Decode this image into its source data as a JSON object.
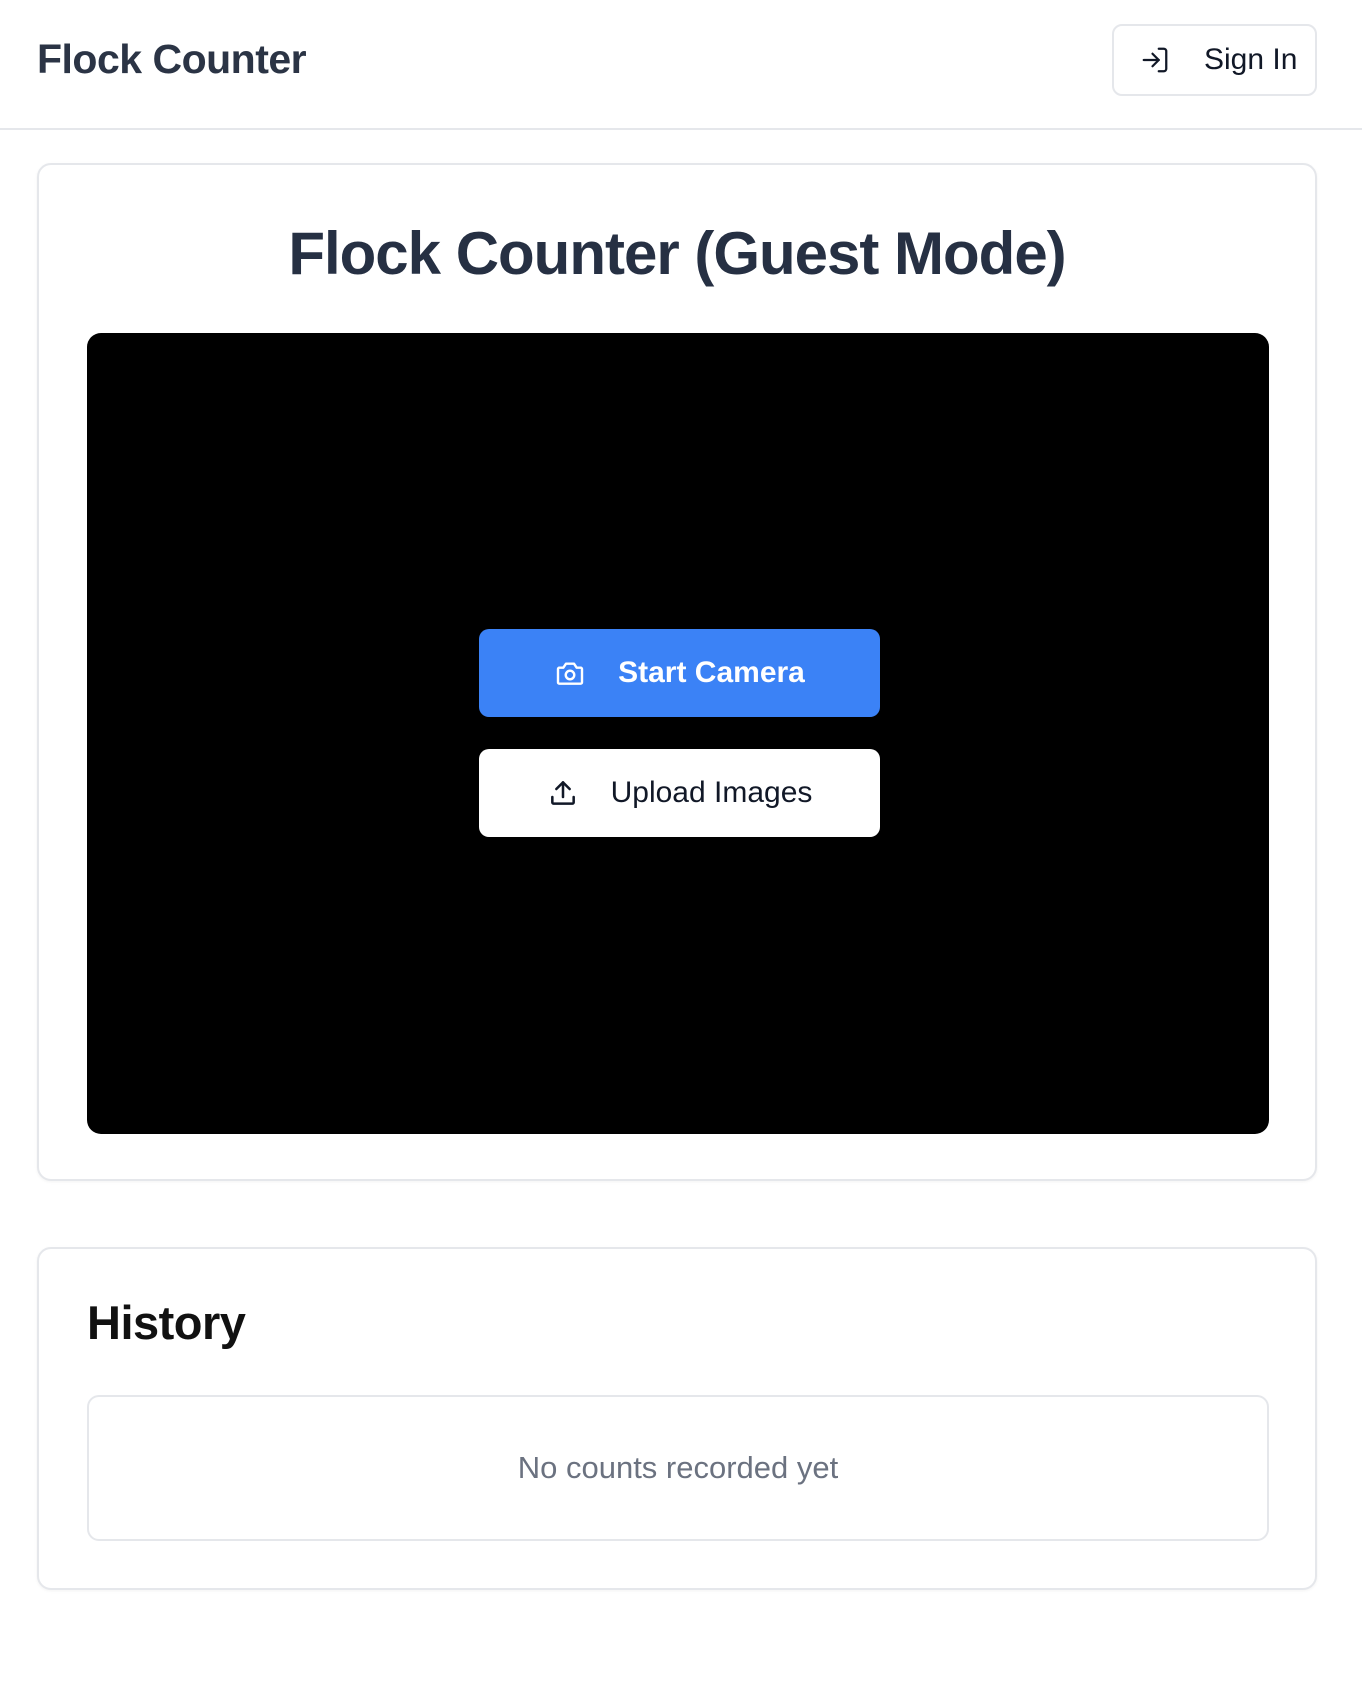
{
  "header": {
    "brand": "Flock Counter",
    "signin_label": "Sign In",
    "signin_icon": "login-arrow-icon"
  },
  "camera_card": {
    "title": "Flock Counter (Guest Mode)",
    "start_camera_label": "Start Camera",
    "start_camera_icon": "camera-icon",
    "upload_label": "Upload Images",
    "upload_icon": "upload-icon"
  },
  "history": {
    "title": "History",
    "empty_message": "No counts recorded yet"
  },
  "colors": {
    "accent": "#3b82f6",
    "viewport_bg": "#000000",
    "border": "#e5e7eb"
  }
}
